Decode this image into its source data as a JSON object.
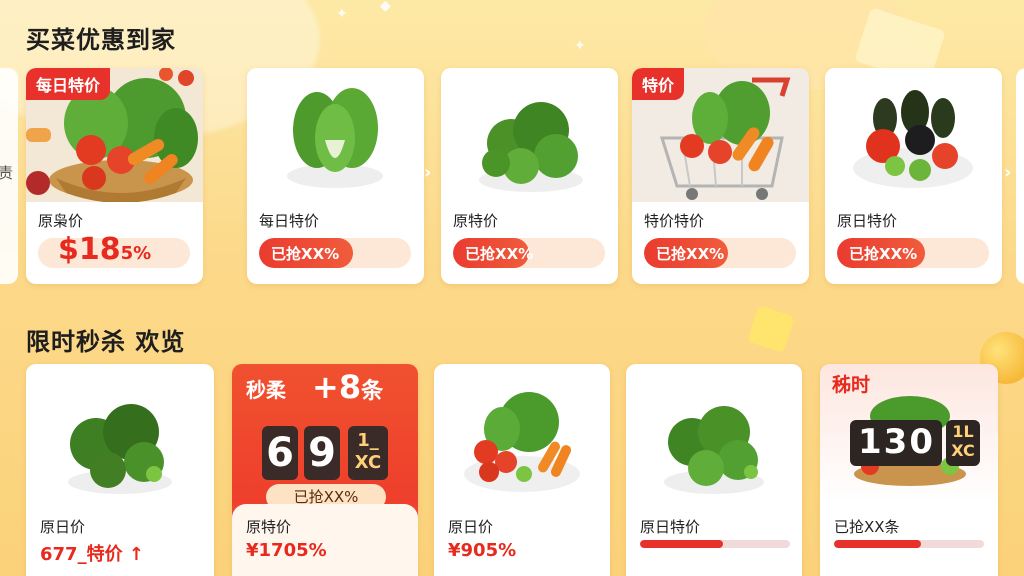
{
  "section1": {
    "title": "买菜优惠到家"
  },
  "section2": {
    "title": "限时秒杀 欢览"
  },
  "row1": {
    "cards": [
      {
        "tag": "每日特价",
        "label": "原枭价",
        "price": "$18",
        "price_small": "5%"
      },
      {
        "label": "每日特价",
        "progress_text": "已抢XX%",
        "progress": 0.62
      },
      {
        "label": "原特价",
        "progress_text": "已抢XX%",
        "progress": 0.5
      },
      {
        "tag": "特价",
        "label": "特价特价",
        "progress_text": "已抢XX%",
        "progress": 0.55
      },
      {
        "label": "原日特价",
        "progress_text": "已抢XX%",
        "progress": 0.58
      }
    ],
    "edge_left": "责"
  },
  "row2": {
    "cards": [
      {
        "label": "原日价",
        "price": "677_特价 ↑"
      },
      {
        "flash_label": "秒柔",
        "flash_count": "+8",
        "flash_suffix": "条",
        "digit1": "6",
        "digit2": "9",
        "mini_top": "1_",
        "mini_bottom": "XC",
        "pill": "已抢XX%",
        "label": "原特价",
        "price": "¥1705%"
      },
      {
        "label": "原日价",
        "price": "¥905%"
      },
      {
        "label": "原日特价",
        "progress": 0.55
      },
      {
        "timer_label": "秭时",
        "digits": "130",
        "mini_top": "1L",
        "mini_bottom": "XC",
        "label": "已抢XX条",
        "progress": 0.58
      }
    ]
  },
  "colors": {
    "accent": "#e8312b",
    "background": "#fcd98a"
  }
}
